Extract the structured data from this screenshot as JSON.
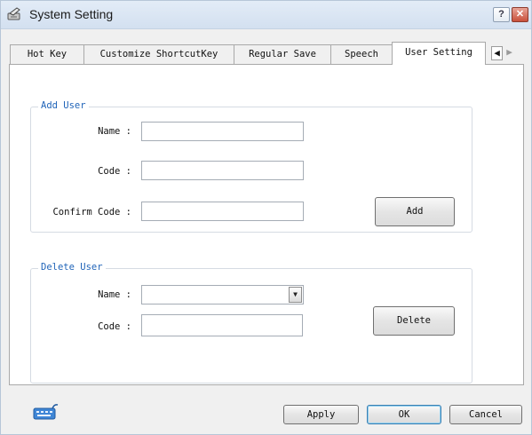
{
  "window": {
    "title": "System Setting",
    "help_label": "?",
    "close_label": "✕"
  },
  "tabs": {
    "items": [
      {
        "label": "Hot Key"
      },
      {
        "label": "Customize ShortcutKey"
      },
      {
        "label": "Regular Save"
      },
      {
        "label": "Speech"
      },
      {
        "label": "User Setting",
        "active": true
      }
    ],
    "scroll_left": "◀",
    "scroll_right": "▶"
  },
  "add_user": {
    "legend": "Add User",
    "name_label": "Name :",
    "name_value": "",
    "code_label": "Code :",
    "code_value": "",
    "confirm_label": "Confirm Code :",
    "confirm_value": "",
    "add_button": "Add"
  },
  "delete_user": {
    "legend": "Delete User",
    "name_label": "Name :",
    "name_value": "",
    "code_label": "Code :",
    "code_value": "",
    "delete_button": "Delete"
  },
  "footer": {
    "keyboard_icon": "keyboard-icon",
    "apply_button": "Apply",
    "ok_button": "OK",
    "cancel_button": "Cancel"
  },
  "colors": {
    "legend": "#1f63b8",
    "title_bar": "#dbe6f3",
    "panel": "#ffffff",
    "dialog": "#f0f0f0"
  }
}
